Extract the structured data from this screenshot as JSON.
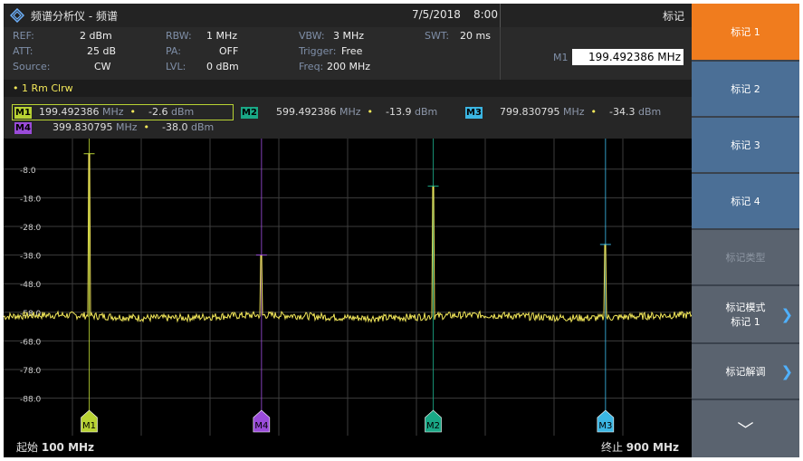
{
  "titlebar": {
    "title": "频谱分析仪 - 频谱",
    "date": "7/5/2018",
    "time": "8:00",
    "menu_title": "标记"
  },
  "params": {
    "ref_label": "REF:",
    "ref_value": "2 dBm",
    "att_label": "ATT:",
    "att_value": "25 dB",
    "source_label": "Source:",
    "source_value": "CW",
    "rbw_label": "RBW:",
    "rbw_value": "1 MHz",
    "pa_label": "PA:",
    "pa_value": "OFF",
    "lvl_label": "LVL:",
    "lvl_value": "0 dBm",
    "vbw_label": "VBW:",
    "vbw_value": "3 MHz",
    "trigger_label": "Trigger:",
    "trigger_value": "Free",
    "freq_label": "Freq:",
    "freq_value": "200 MHz",
    "swt_label": "SWT:",
    "swt_value": "20 ms",
    "marker_entry_label": "M1",
    "marker_entry_value": "199.492386 MHz"
  },
  "trace": {
    "label": "1 Rm  Clrw"
  },
  "markers": [
    {
      "id": "M1",
      "freq": "199.492386",
      "unit": "MHz",
      "level": "-2.6",
      "level_unit": "dBm",
      "color": "#b8d233"
    },
    {
      "id": "M2",
      "freq": "599.492386",
      "unit": "MHz",
      "level": "-13.9",
      "level_unit": "dBm",
      "color": "#1aa886"
    },
    {
      "id": "M3",
      "freq": "799.830795",
      "unit": "MHz",
      "level": "-34.3",
      "level_unit": "dBm",
      "color": "#3bb6e3"
    },
    {
      "id": "M4",
      "freq": "399.830795",
      "unit": "MHz",
      "level": "-38.0",
      "level_unit": "dBm",
      "color": "#9a4bd9"
    }
  ],
  "plot": {
    "y_labels": [
      "-8.0",
      "-18.0",
      "-28.0",
      "-38.0",
      "-48.0",
      "-58.0",
      "-68.0",
      "-78.0",
      "-88.0"
    ],
    "start_label": "起始",
    "start_value": "100 MHz",
    "stop_label": "终止",
    "stop_value": "900 MHz",
    "trace_color": "#f3e85a"
  },
  "softkeys": {
    "marker1": "标记 1",
    "marker2": "标记 2",
    "marker3": "标记 3",
    "marker4": "标记 4",
    "marker_type": "标记类型",
    "marker_mode_line1": "标记模式",
    "marker_mode_line2": "标记 1",
    "marker_demod": "标记解调",
    "more": "﹀"
  }
}
